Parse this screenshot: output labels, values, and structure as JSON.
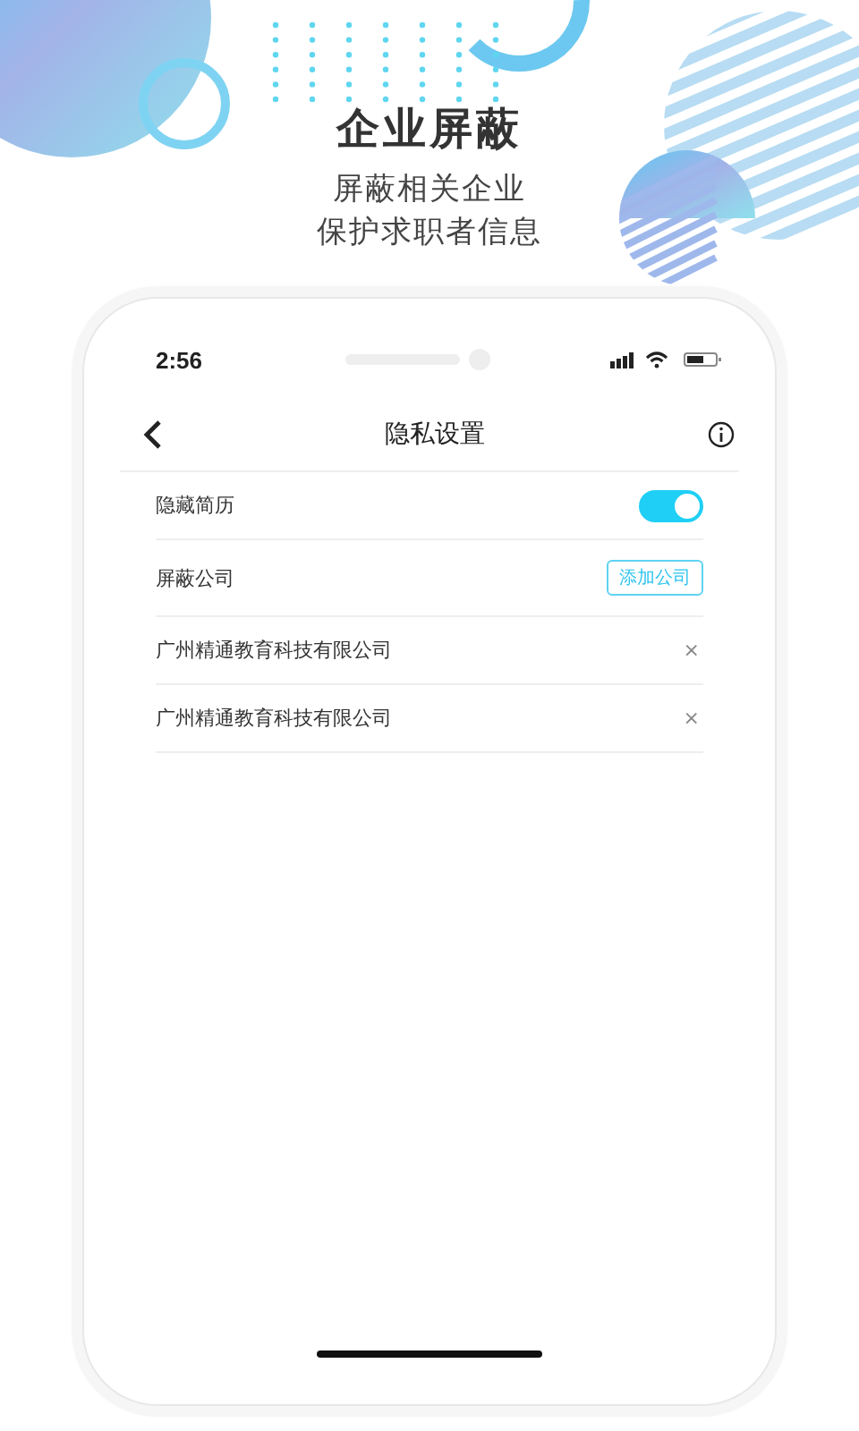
{
  "promo": {
    "title": "企业屏蔽",
    "subtitle_lines": [
      "屏蔽相关企业",
      "保护求职者信息"
    ]
  },
  "status_bar": {
    "time": "2:56"
  },
  "nav": {
    "title": "隐私设置"
  },
  "settings": [
    {
      "kind": "toggle",
      "label": "隐藏简历",
      "on": true
    },
    {
      "kind": "action",
      "label": "屏蔽公司",
      "button": "添加公司"
    }
  ],
  "blocked_companies": [
    {
      "name": "广州精通教育科技有限公司",
      "remove": "×"
    },
    {
      "name": "广州精通教育科技有限公司",
      "remove": "×"
    }
  ]
}
